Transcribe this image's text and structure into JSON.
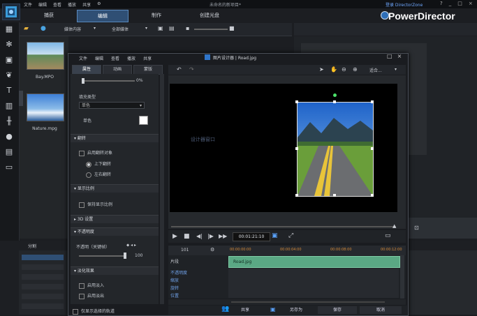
{
  "app": {
    "window_title": "未命名的新项目*",
    "menu": [
      "文件",
      "编辑",
      "查看",
      "播放",
      "共享",
      "?"
    ],
    "login_link": "登录 DirectorZone",
    "window_controls": [
      "?",
      "_",
      "□",
      "×"
    ],
    "brand": "PowerDirector",
    "tabs": [
      {
        "label": "捕获"
      },
      {
        "label": "编辑"
      },
      {
        "label": "制作"
      },
      {
        "label": "创建光盘"
      }
    ],
    "active_tab": "编辑"
  },
  "library": {
    "toolbar": {
      "filter": "媒体内容",
      "view": "全部媒体"
    },
    "items": [
      {
        "caption": "Bay.MPO"
      },
      {
        "caption": "Nature.mpg"
      }
    ]
  },
  "split_label": "分割",
  "dialog": {
    "menu": [
      "文件",
      "编辑",
      "查看",
      "播放",
      "共享"
    ],
    "title": "图片设计器 | Road.jpg",
    "controls": [
      "□",
      "×"
    ],
    "panel_tabs": [
      "属性",
      "动画",
      "蒙版"
    ],
    "active_panel_tab": "属性",
    "opacity_value": "0%",
    "fill_type_label": "填充类型",
    "fill_type_value": "单色",
    "solid_color_label": "单色",
    "sections": {
      "flip": {
        "title": "翻转",
        "enable_label": "启用翻转对象",
        "options": [
          "上下翻转",
          "左右翻转"
        ],
        "selected": "上下翻转"
      },
      "aspect": {
        "title": "显示比例",
        "keep_label": "保持显示比例"
      },
      "three_d": {
        "title": "3D 设置"
      },
      "opacity": {
        "title": "不透明度",
        "keyframe_label": "不透明（关键帧）",
        "value": "100"
      },
      "fade": {
        "title": "淡化效果",
        "fade_in": "启用淡入",
        "fade_out": "启用淡出"
      }
    },
    "tool_menu": "适合...",
    "canvas_text": "设计器窗口",
    "timecode": "00:01:21:10",
    "timeline": {
      "position": "101",
      "ticks": [
        "00:00:00:00",
        "00:00:04:00",
        "00:00:08:00",
        "00:00:12:00"
      ],
      "tracks": [
        {
          "label": "片段",
          "clip": "Road.jpg"
        },
        {
          "label": "不透明度"
        },
        {
          "label": "缩放"
        },
        {
          "label": "旋转"
        },
        {
          "label": "位置"
        }
      ]
    },
    "footer_check": "仅显示选择的轨道",
    "buttons": {
      "share": "共享",
      "save_as": "另存为",
      "save": "保存",
      "cancel": "取消"
    }
  }
}
